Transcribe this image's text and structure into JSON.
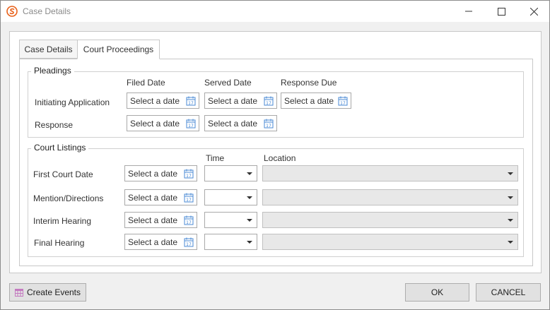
{
  "window": {
    "title": "Case Details",
    "icons": {
      "app": "s-logo-icon",
      "minimize": "minimize-icon",
      "maximize": "maximize-icon",
      "close": "close-icon"
    },
    "accent": "#e8611a"
  },
  "tabs": [
    {
      "label": "Case Details",
      "active": false
    },
    {
      "label": "Court Proceedings",
      "active": true
    }
  ],
  "pleadings": {
    "legend": "Pleadings",
    "columns": {
      "filed": "Filed Date",
      "served": "Served Date",
      "response_due": "Response Due"
    },
    "rows": [
      {
        "label": "Initiating Application",
        "filed": "Select a date",
        "served": "Select a date",
        "response_due": "Select a date"
      },
      {
        "label": "Response",
        "filed": "Select a date",
        "served": "Select a date"
      }
    ]
  },
  "court_listings": {
    "legend": "Court Listings",
    "columns": {
      "time": "Time",
      "location": "Location"
    },
    "rows": [
      {
        "label": "First Court Date",
        "date": "Select a date",
        "time": "",
        "location": ""
      },
      {
        "label": "Mention/Directions",
        "date": "Select a date",
        "time": "",
        "location": ""
      },
      {
        "label": "Interim Hearing",
        "date": "Select a date",
        "time": "",
        "location": ""
      },
      {
        "label": "Final Hearing",
        "date": "Select a date",
        "time": "",
        "location": ""
      }
    ]
  },
  "footer": {
    "create_events": "Create Events",
    "create_events_icon": "calendar-grid-icon",
    "ok": "OK",
    "cancel": "CANCEL"
  },
  "colors": {
    "calendar_icon": "#4a8ad4",
    "create_events_icon": "#c47ac0"
  }
}
